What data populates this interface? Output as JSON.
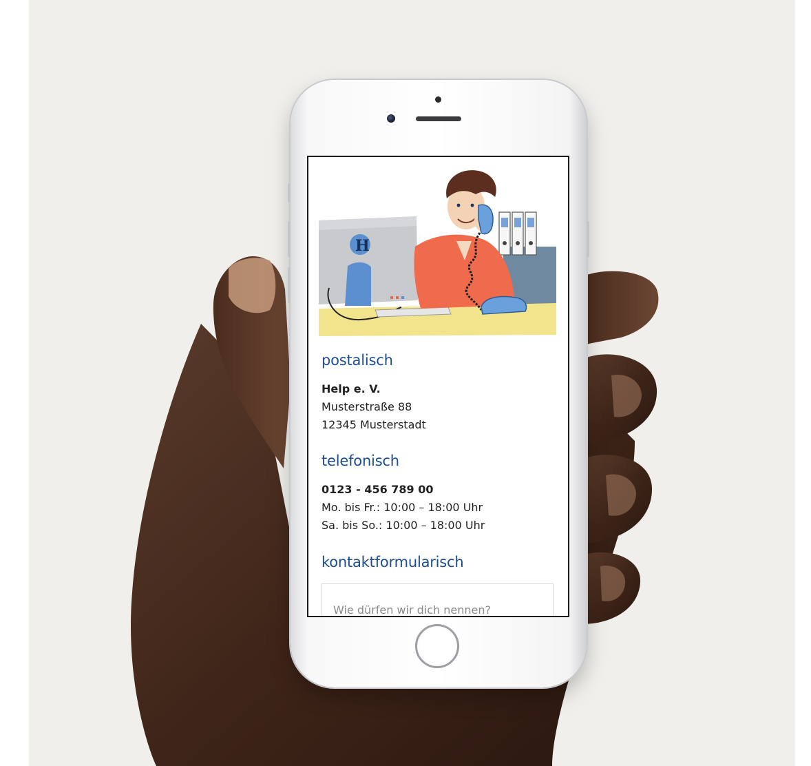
{
  "contact": {
    "postal": {
      "heading": "postalisch",
      "name": "Help e. V.",
      "street": "Musterstraße 88",
      "city": "12345 Musterstadt"
    },
    "phone": {
      "heading": "telefonisch",
      "number": "0123 - 456 789 00",
      "hours_weekdays": "Mo. bis Fr.: 10:00 – 18:00 Uhr",
      "hours_weekend": "Sa. bis So.: 10:00 – 18:00 Uhr"
    },
    "form": {
      "heading": "kontaktformularisch",
      "name_placeholder": "Wie dürfen wir dich nennen?"
    }
  },
  "colors": {
    "heading": "#1d4e8f",
    "shirt": "#f06a4c",
    "desk": "#f3e48b",
    "monitor": "#c8c9cc",
    "logo_blue": "#5b8fd0"
  }
}
